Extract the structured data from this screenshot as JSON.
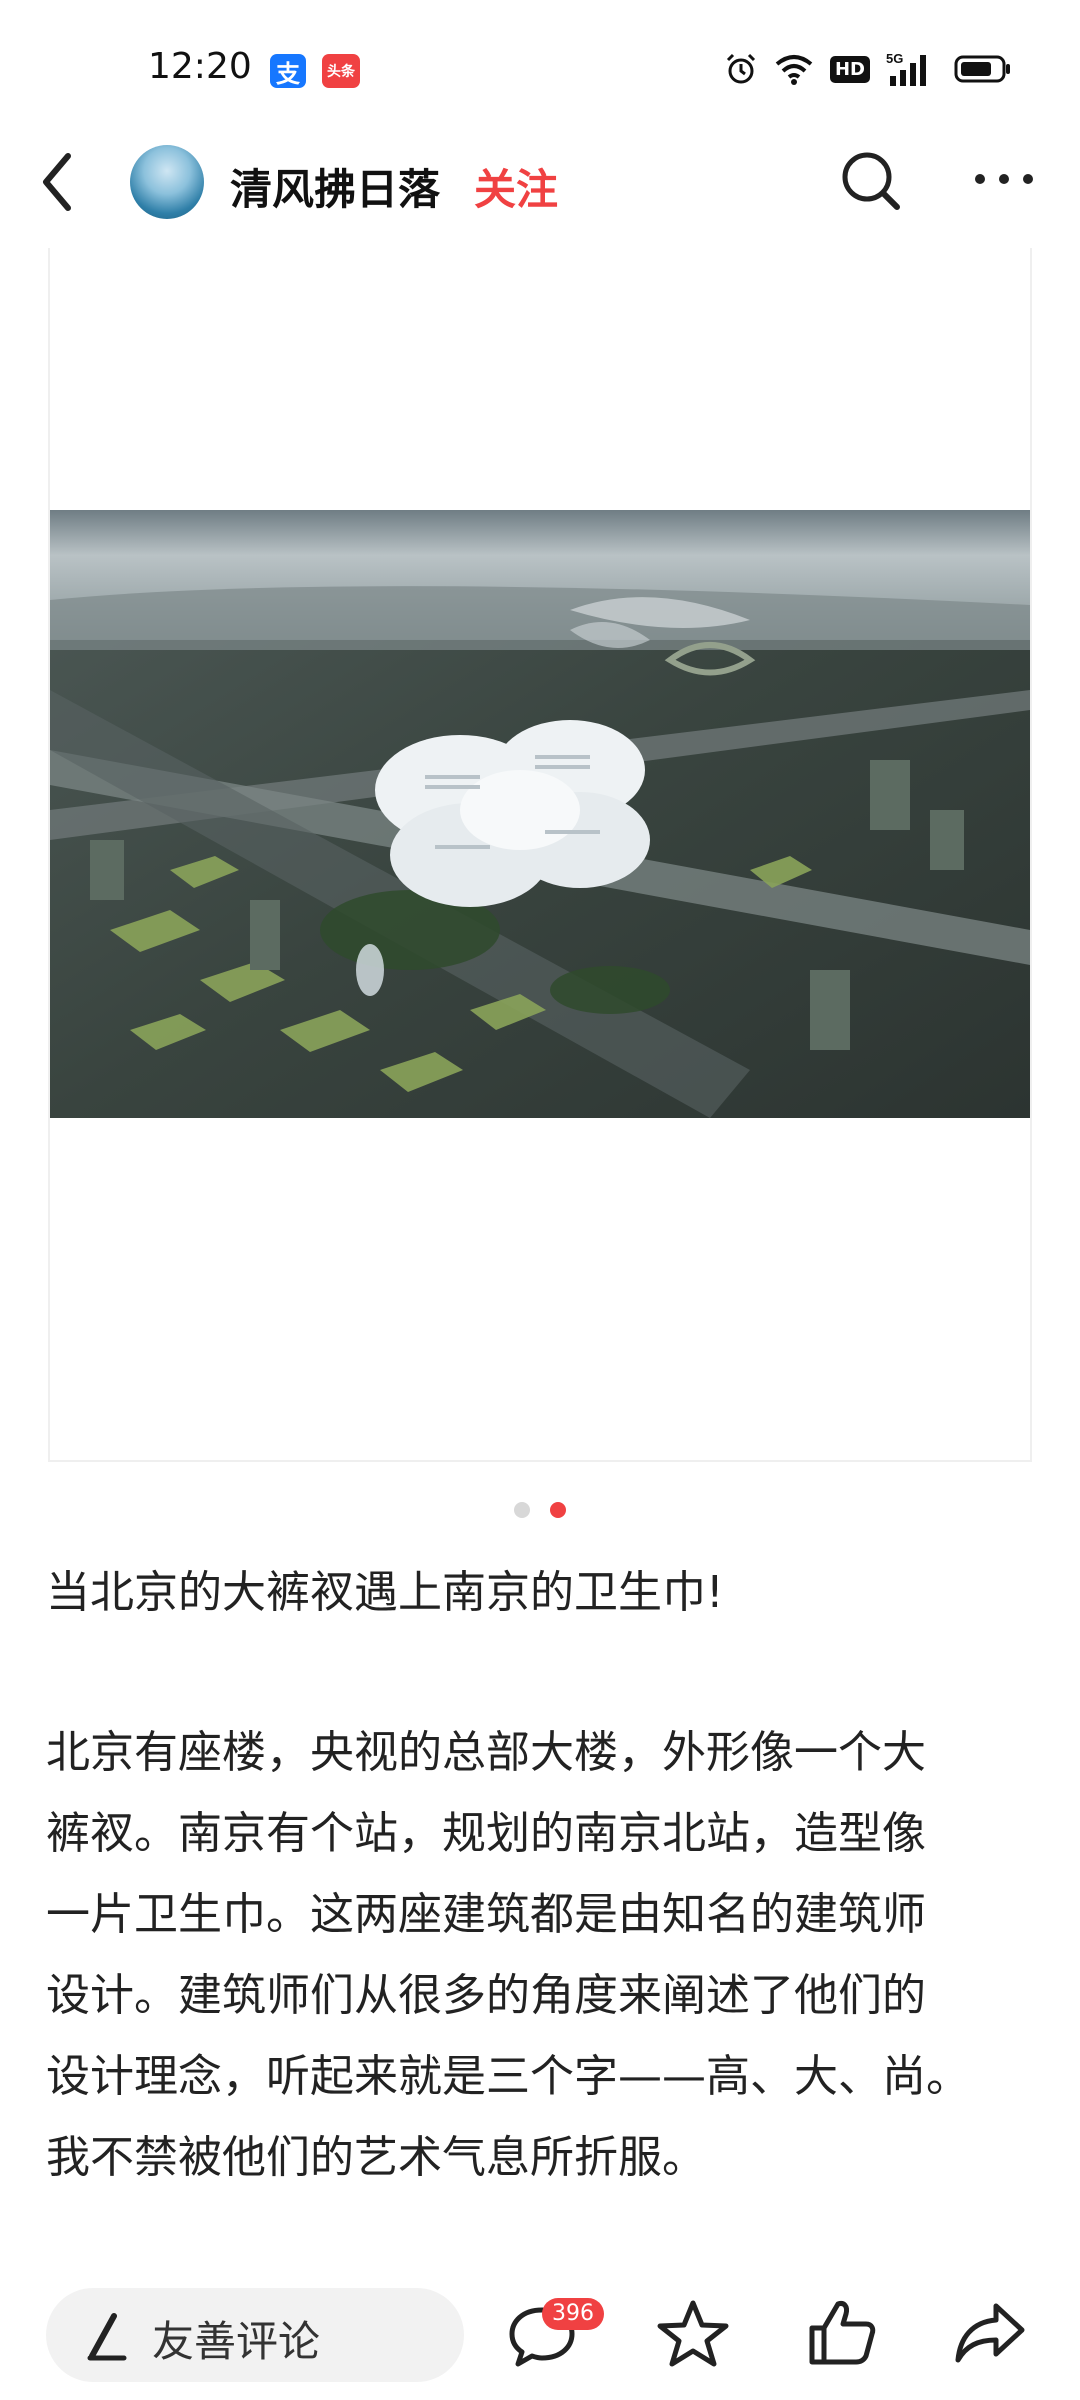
{
  "status_bar": {
    "time": "12:20",
    "app_badges": [
      "支",
      "头条"
    ],
    "hd_label": "HD",
    "network_label": "5G",
    "icons": [
      "alarm-icon",
      "wifi-icon",
      "signal-icon",
      "battery-icon"
    ]
  },
  "header": {
    "back_icon": "chevron-left-icon",
    "author_name": "清风拂日落",
    "follow_label": "关注",
    "search_icon": "search-icon",
    "more_icon": "more-icon"
  },
  "carousel": {
    "page_count": 2,
    "active_index": 2
  },
  "article": {
    "headline": "当北京的大裤衩遇上南京的卫生巾!",
    "body_lines": [
      "北京有座楼，央视的总部大楼，外形像一个大",
      "裤衩。南京有个站，规划的南京北站，造型像",
      "一片卫生巾。这两座建筑都是由知名的建筑师",
      "设计。建筑师们从很多的角度来阐述了他们的",
      "设计理念，听起来就是三个字——高、大、尚。",
      "我不禁被他们的艺术气息所折服。"
    ]
  },
  "bottom_bar": {
    "comment_placeholder": "友善评论",
    "comment_count": "396",
    "icons": [
      "pen-icon",
      "comment-icon",
      "star-icon",
      "like-icon",
      "share-icon"
    ]
  },
  "colors": {
    "accent": "#f04142",
    "alipay_blue": "#1677ff",
    "text": "#222222"
  }
}
